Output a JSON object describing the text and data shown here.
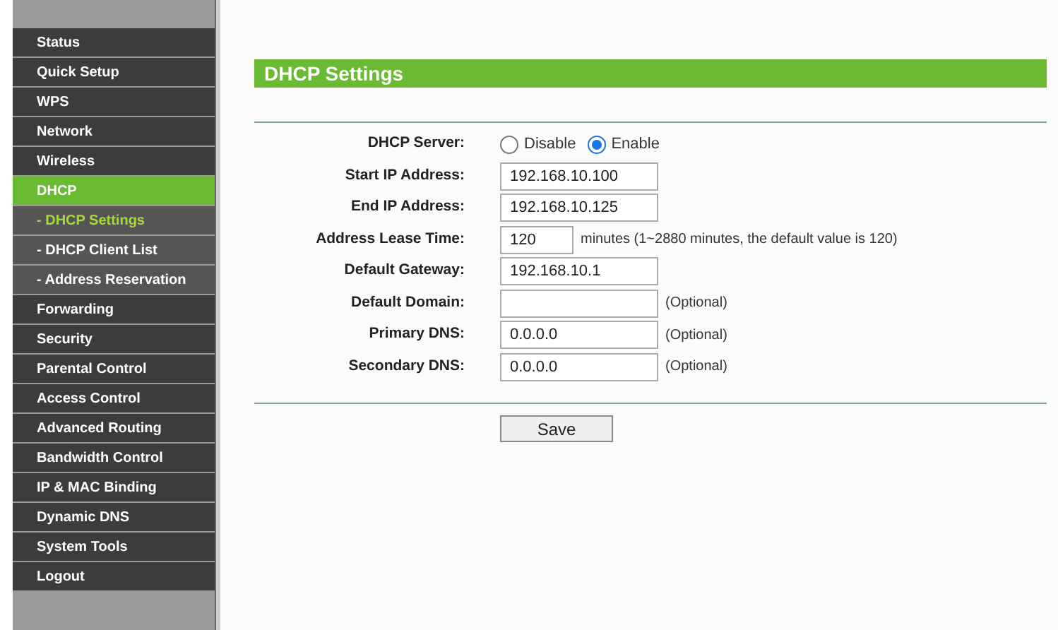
{
  "sidebar": {
    "items": [
      {
        "label": "Status",
        "kind": "main",
        "selected": false
      },
      {
        "label": "Quick Setup",
        "kind": "main",
        "selected": false
      },
      {
        "label": "WPS",
        "kind": "main",
        "selected": false
      },
      {
        "label": "Network",
        "kind": "main",
        "selected": false
      },
      {
        "label": "Wireless",
        "kind": "main",
        "selected": false
      },
      {
        "label": "DHCP",
        "kind": "main",
        "selected": true
      },
      {
        "label": "- DHCP Settings",
        "kind": "sub",
        "selected": true
      },
      {
        "label": "- DHCP Client List",
        "kind": "sub",
        "selected": false
      },
      {
        "label": "- Address Reservation",
        "kind": "sub",
        "selected": false
      },
      {
        "label": "Forwarding",
        "kind": "main",
        "selected": false
      },
      {
        "label": "Security",
        "kind": "main",
        "selected": false
      },
      {
        "label": "Parental Control",
        "kind": "main",
        "selected": false
      },
      {
        "label": "Access Control",
        "kind": "main",
        "selected": false
      },
      {
        "label": "Advanced Routing",
        "kind": "main",
        "selected": false
      },
      {
        "label": "Bandwidth Control",
        "kind": "main",
        "selected": false
      },
      {
        "label": "IP & MAC Binding",
        "kind": "main",
        "selected": false
      },
      {
        "label": "Dynamic DNS",
        "kind": "main",
        "selected": false
      },
      {
        "label": "System Tools",
        "kind": "main",
        "selected": false
      },
      {
        "label": "Logout",
        "kind": "main",
        "selected": false
      }
    ]
  },
  "panel": {
    "title": "DHCP Settings",
    "fields": [
      {
        "kind": "radio",
        "label": "DHCP Server:",
        "options": [
          {
            "label": "Disable",
            "selected": false
          },
          {
            "label": "Enable",
            "selected": true
          }
        ]
      },
      {
        "kind": "text",
        "label": "Start IP Address:",
        "value": "192.168.10.100"
      },
      {
        "kind": "text",
        "label": "End IP Address:",
        "value": "192.168.10.125"
      },
      {
        "kind": "short",
        "label": "Address Lease Time:",
        "value": "120",
        "note": "minutes (1~2880 minutes, the default value is 120)"
      },
      {
        "kind": "text",
        "label": "Default Gateway:",
        "value": "192.168.10.1"
      },
      {
        "kind": "text",
        "label": "Default Domain:",
        "note": "(Optional)"
      },
      {
        "kind": "text",
        "label": "Primary DNS:",
        "value": "0.0.0.0",
        "note": "(Optional)"
      },
      {
        "kind": "text",
        "label": "Secondary DNS:",
        "value": "0.0.0.0",
        "note": "(Optional)"
      }
    ],
    "save_button": "Save"
  }
}
